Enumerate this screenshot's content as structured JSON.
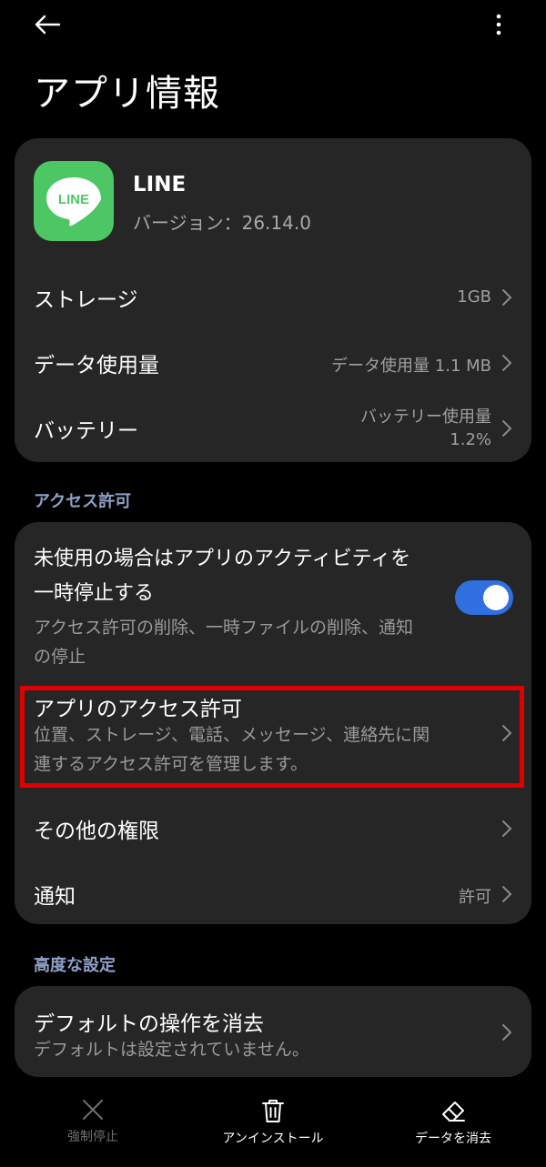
{
  "page": {
    "title": "アプリ情報"
  },
  "app": {
    "name": "LINE",
    "version": "バージョン：26.14.0",
    "icon_text": "LINE",
    "icon_color": "#4cc764"
  },
  "info_rows": [
    {
      "title": "ストレージ",
      "value": "1GB"
    },
    {
      "title": "データ使用量",
      "value": "データ使用量 1.1 MB"
    },
    {
      "title": "バッテリー",
      "value_line1": "バッテリー使用量",
      "value_line2": "1.2%"
    }
  ],
  "access_section": {
    "header": "アクセス許可",
    "pause_title_line1": "未使用の場合はアプリのアクティビティを",
    "pause_title_line2": "一時停止する",
    "pause_sub_line1": "アクセス許可の削除、一時ファイルの削除、通知",
    "pause_sub_line2": "の停止",
    "pause_toggle_on": true,
    "app_perm_title": "アプリのアクセス許可",
    "app_perm_sub_line1": "位置、ストレージ、電話、メッセージ、連絡先に関",
    "app_perm_sub_line2": "連するアクセス許可を管理します。",
    "other_title": "その他の権限",
    "notify_title": "通知",
    "notify_value": "許可"
  },
  "advanced_section": {
    "header": "高度な設定",
    "default_title": "デフォルトの操作を消去",
    "default_sub": "デフォルトは設定されていません。"
  },
  "bottom_bar": {
    "force_stop": "強制停止",
    "uninstall": "アンインストール",
    "clear_data": "データを消去"
  },
  "colors": {
    "accent": "#2f6fe0",
    "highlight": "#e00000",
    "section_header": "#8fa0c8"
  }
}
